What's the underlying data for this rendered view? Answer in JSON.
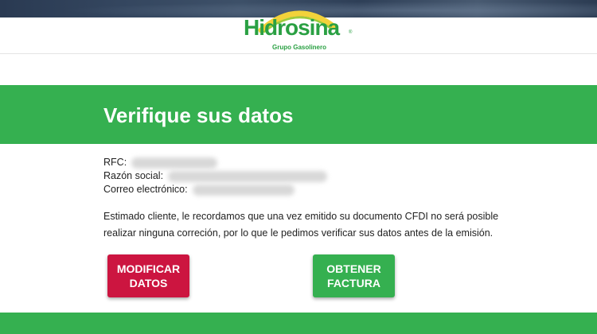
{
  "brand": {
    "name": "Hidrosina",
    "tagline": "Grupo Gasolinero",
    "registered_mark": "®",
    "color_green": "#35b050",
    "color_red": "#cc1540"
  },
  "page": {
    "title": "Verifique sus datos"
  },
  "fields": {
    "rfc_label": "RFC:",
    "razon_label": "Razón social:",
    "correo_label": "Correo electrónico:"
  },
  "notice": "Estimado cliente, le recordamos que una vez emitido su documento CFDI no será posible realizar ninguna correción, por lo que le pedimos verificar sus datos antes de la emisión.",
  "buttons": {
    "modify_line1": "MODIFICAR",
    "modify_line2": "DATOS",
    "get_line1": "OBTENER",
    "get_line2": "FACTURA"
  }
}
